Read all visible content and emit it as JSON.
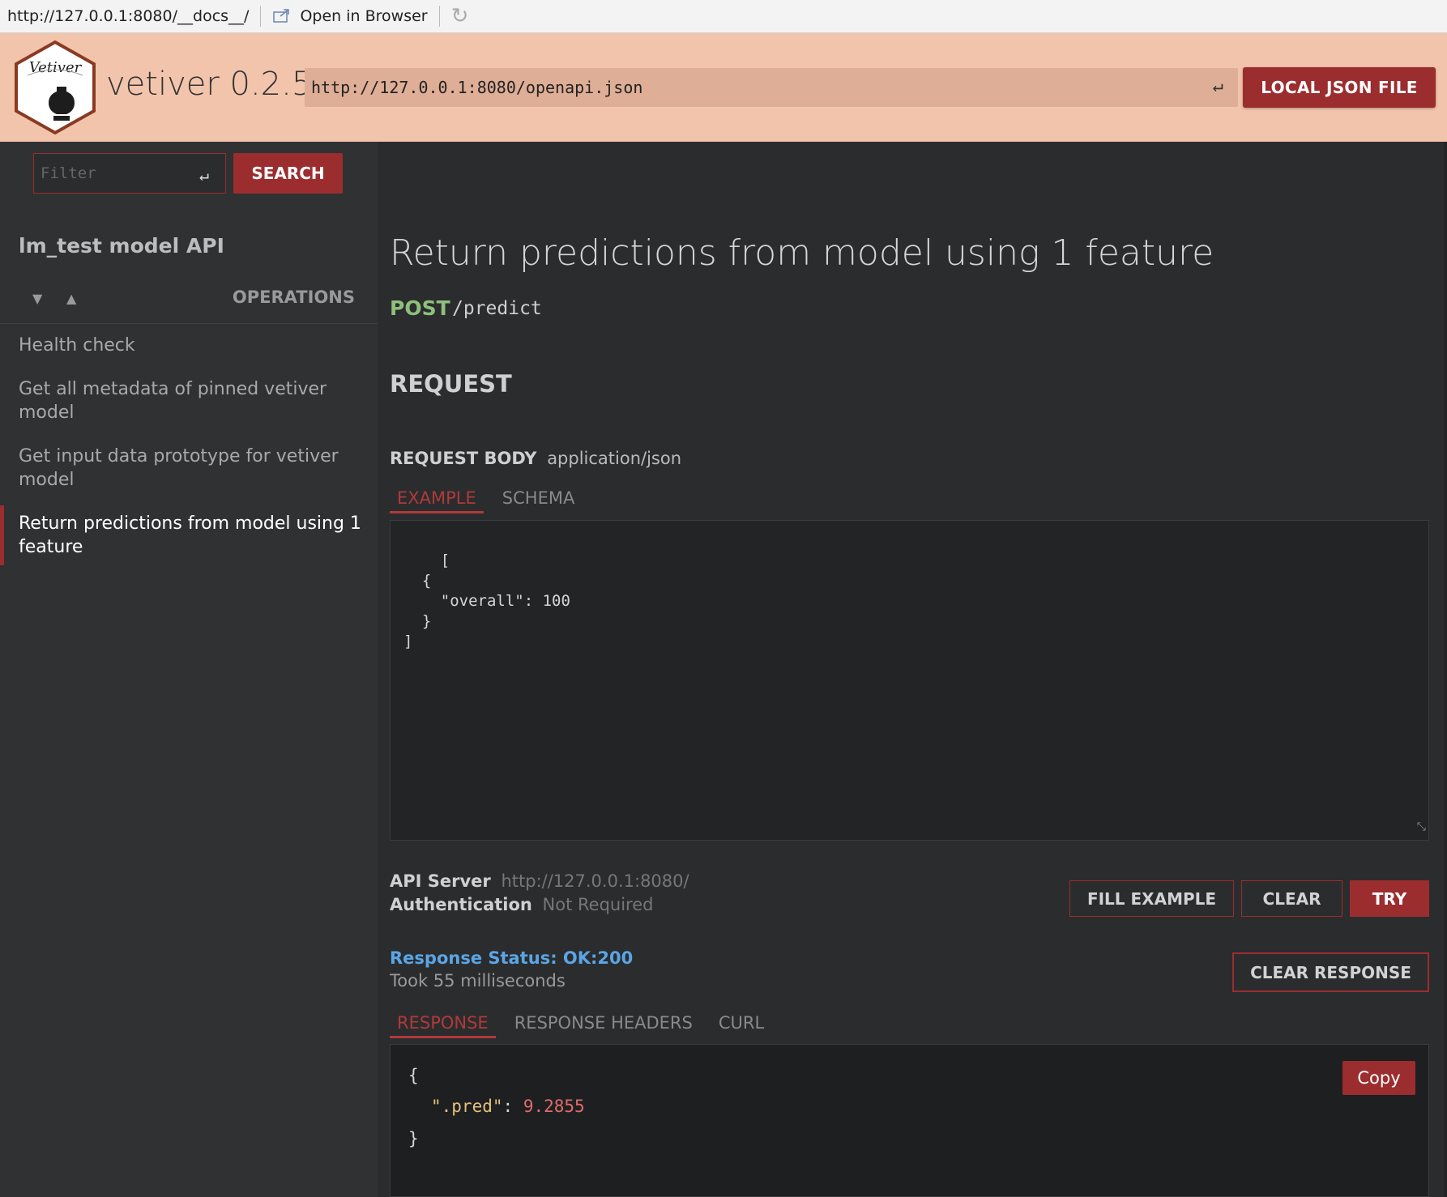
{
  "browser": {
    "url": "http://127.0.0.1:8080/__docs__/",
    "open_in_browser": "Open in Browser"
  },
  "header": {
    "logo_text": "Vetiver",
    "brand": "vetiver 0.2.5",
    "spec_url": "http://127.0.0.1:8080/openapi.json",
    "local_json_button": "LOCAL JSON FILE"
  },
  "sidebar": {
    "filter_placeholder": "Filter",
    "search_button": "SEARCH",
    "api_title": "lm_test model API",
    "operations_label": "OPERATIONS",
    "items": [
      {
        "label": "Health check",
        "active": false
      },
      {
        "label": "Get all metadata of pinned vetiver model",
        "active": false
      },
      {
        "label": "Get input data prototype for vetiver model",
        "active": false
      },
      {
        "label": "Return predictions from model using 1 feature",
        "active": true
      }
    ]
  },
  "main": {
    "operation_title": "Return predictions from model using 1 feature",
    "method": "POST",
    "path": "/predict",
    "request_heading": "REQUEST",
    "request_body_label": "REQUEST BODY",
    "request_body_type": "application/json",
    "body_tabs": [
      "EXAMPLE",
      "SCHEMA"
    ],
    "example_body": "[\n  {\n    \"overall\": 100\n  }\n]",
    "api_server_label": "API Server",
    "api_server_value": "http://127.0.0.1:8080/",
    "auth_label": "Authentication",
    "auth_value": "Not Required",
    "buttons": {
      "fill_example": "FILL EXAMPLE",
      "clear": "CLEAR",
      "try": "TRY",
      "clear_response": "CLEAR RESPONSE",
      "copy": "Copy"
    },
    "response_status": "Response Status: OK:200",
    "response_time": "Took 55 milliseconds",
    "response_tabs": [
      "RESPONSE",
      "RESPONSE HEADERS",
      "CURL"
    ],
    "response": {
      "open": "{",
      "key": "\".pred\"",
      "colon": ": ",
      "value": "9.2855",
      "close": "}"
    }
  },
  "colors": {
    "header_bg": "#f2c4ac",
    "accent": "#9b2d2f",
    "method_post": "#8ec07c",
    "status_ok": "#5ba5e6"
  }
}
